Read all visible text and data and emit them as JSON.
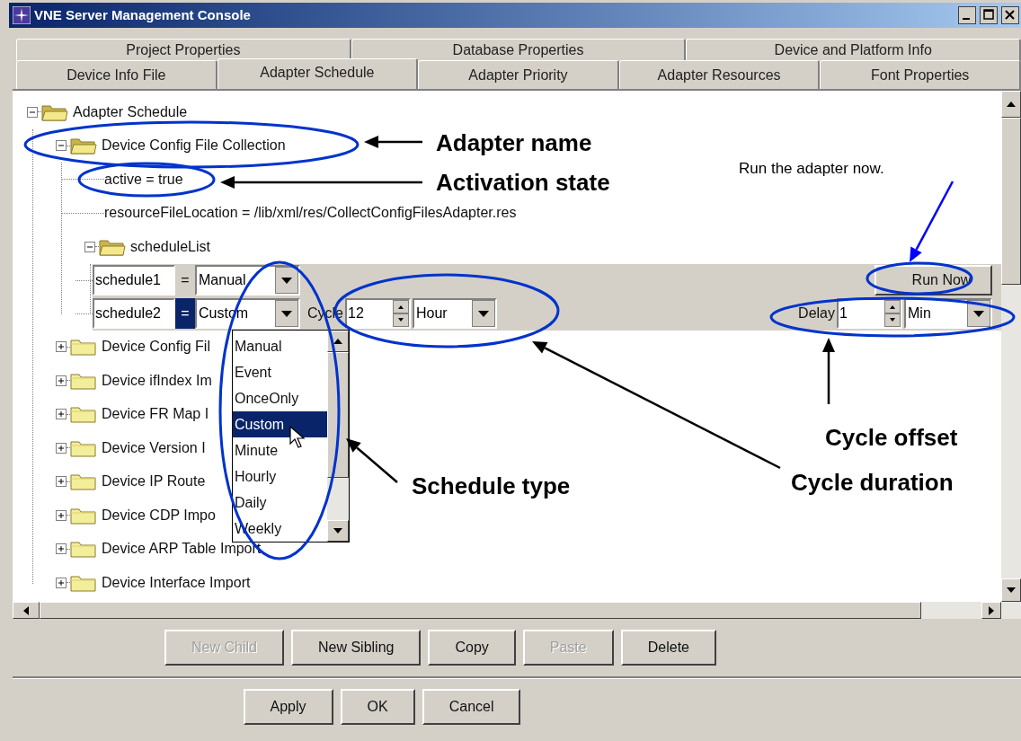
{
  "window": {
    "title": "VNE Server Management Console"
  },
  "tabs": [
    [
      {
        "label": "Project Properties",
        "selected": false
      },
      {
        "label": "Database Properties",
        "selected": false
      },
      {
        "label": "Device and Platform Info",
        "selected": false
      }
    ],
    [
      {
        "label": "Device Info File",
        "selected": false
      },
      {
        "label": "Adapter Schedule",
        "selected": true
      },
      {
        "label": "Adapter Priority",
        "selected": false
      },
      {
        "label": "Adapter Resources",
        "selected": false
      },
      {
        "label": "Font Properties",
        "selected": false
      }
    ]
  ],
  "tree": {
    "label": "Adapter Schedule",
    "kind": "folder",
    "expanded": true,
    "children": [
      {
        "label": "Device Config File Collection",
        "kind": "folder",
        "expanded": true,
        "children": [
          {
            "label": "active = true",
            "kind": "property"
          },
          {
            "label": "resourceFileLocation = /lib/xml/res/CollectConfigFilesAdapter.res",
            "kind": "property"
          },
          {
            "label": "scheduleList",
            "kind": "folder",
            "expanded": true,
            "children": [
              {
                "kind": "schedule",
                "name": "schedule1",
                "equals": "=",
                "value": "Manual",
                "selected": false,
                "run_button": "Run Now"
              },
              {
                "kind": "schedule",
                "name": "schedule2",
                "equals": "=",
                "value": "Custom",
                "selected": true,
                "cycle": {
                  "label": "Cycle",
                  "value": "12",
                  "unit": "Hour"
                },
                "delay": {
                  "label": "Delay",
                  "value": "1",
                  "unit": "Min"
                }
              }
            ]
          }
        ]
      },
      {
        "label": "Device Config Fil",
        "kind": "folder",
        "expanded": false
      },
      {
        "label": "Device ifIndex Im",
        "kind": "folder",
        "expanded": false
      },
      {
        "label": "Device FR Map I",
        "kind": "folder",
        "expanded": false
      },
      {
        "label": "Device Version I",
        "kind": "folder",
        "expanded": false
      },
      {
        "label": "Device IP Route",
        "kind": "folder",
        "expanded": false
      },
      {
        "label": "Device CDP Impo",
        "kind": "folder",
        "expanded": false
      },
      {
        "label": "Device ARP Table Import",
        "kind": "folder",
        "expanded": false
      },
      {
        "label": "Device Interface Import",
        "kind": "folder",
        "expanded": false
      }
    ]
  },
  "dropdown_list": {
    "options": [
      {
        "label": "Manual",
        "selected": false
      },
      {
        "label": "Event",
        "selected": false
      },
      {
        "label": "OnceOnly",
        "selected": false
      },
      {
        "label": "Custom",
        "selected": true
      },
      {
        "label": "Minute",
        "selected": false
      },
      {
        "label": "Hourly",
        "selected": false
      },
      {
        "label": "Daily",
        "selected": false
      },
      {
        "label": "Weekly",
        "selected": false
      }
    ]
  },
  "tree_buttons": [
    {
      "label": "New Child",
      "disabled": true
    },
    {
      "label": "New Sibling",
      "disabled": false
    },
    {
      "label": "Copy",
      "disabled": false
    },
    {
      "label": "Paste",
      "disabled": true
    },
    {
      "label": "Delete",
      "disabled": false
    }
  ],
  "dialog_buttons": [
    {
      "label": "Apply"
    },
    {
      "label": "OK"
    },
    {
      "label": "Cancel"
    }
  ],
  "annotations": [
    {
      "kind": "label",
      "text": "Adapter name"
    },
    {
      "kind": "label",
      "text": "Activation state"
    },
    {
      "kind": "note",
      "text": "Run the adapter now."
    },
    {
      "kind": "label",
      "text": "Cycle offset"
    },
    {
      "kind": "label",
      "text": "Schedule type"
    },
    {
      "kind": "label",
      "text": "Cycle duration"
    }
  ]
}
